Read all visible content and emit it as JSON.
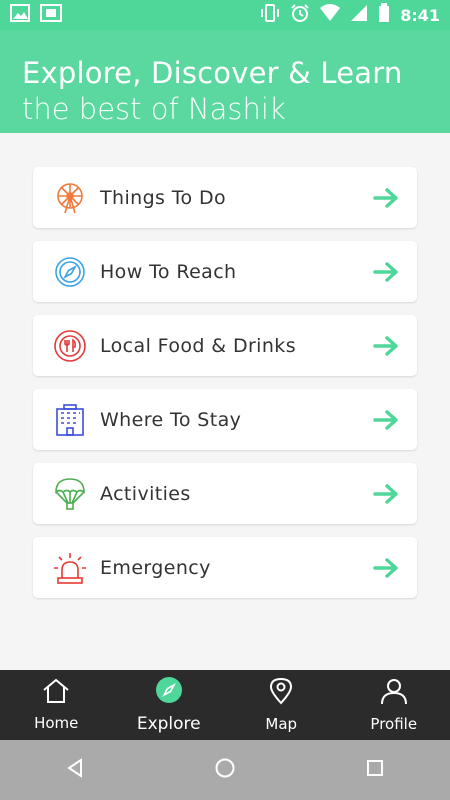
{
  "status_bar": {
    "time": "8:41",
    "left_icons": [
      "image-icon",
      "screen-record-icon"
    ],
    "right_icons": [
      "vibrate-icon",
      "alarm-icon",
      "wifi-icon",
      "signal-icon",
      "battery-icon"
    ]
  },
  "header": {
    "title": "Explore, Discover & Learn",
    "subtitle": "the best of Nashik"
  },
  "list": {
    "items": [
      {
        "label": "Things To Do",
        "icon": "ferris-wheel-icon",
        "color": "#f07a3a"
      },
      {
        "label": "How To Reach",
        "icon": "compass-icon",
        "color": "#3aa3e3"
      },
      {
        "label": "Local Food & Drinks",
        "icon": "plate-cutlery-icon",
        "color": "#e23b3b"
      },
      {
        "label": "Where To Stay",
        "icon": "hotel-building-icon",
        "color": "#3b4fd8"
      },
      {
        "label": "Activities",
        "icon": "parachute-icon",
        "color": "#4caf50"
      },
      {
        "label": "Emergency",
        "icon": "siren-icon",
        "color": "#e53935"
      }
    ],
    "arrow_color": "#4fd79a"
  },
  "bottom_nav": {
    "items": [
      {
        "label": "Home",
        "icon": "home-icon"
      },
      {
        "label": "Explore",
        "icon": "compass-icon",
        "active": true
      },
      {
        "label": "Map",
        "icon": "map-pin-icon"
      },
      {
        "label": "Profile",
        "icon": "profile-icon"
      }
    ]
  },
  "system_nav": {
    "buttons": [
      "back-icon",
      "home-circle-icon",
      "recents-icon"
    ]
  }
}
